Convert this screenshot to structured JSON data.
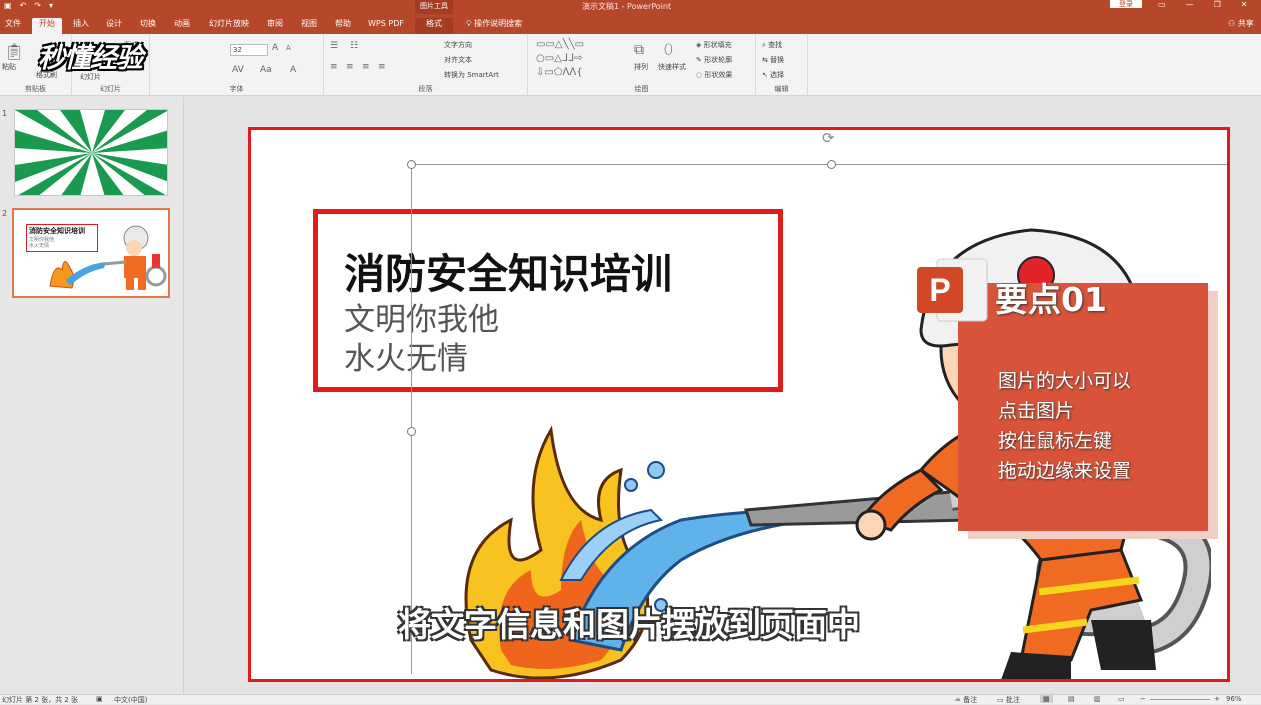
{
  "window": {
    "doc_title": "演示文稿1 - PowerPoint",
    "tool_title": "图片工具",
    "login": "登录",
    "share": "共享",
    "tell_me": "操作说明搜索"
  },
  "tabs": [
    {
      "label": "文件"
    },
    {
      "label": "开始"
    },
    {
      "label": "插入"
    },
    {
      "label": "设计"
    },
    {
      "label": "切换"
    },
    {
      "label": "动画"
    },
    {
      "label": "幻灯片放映"
    },
    {
      "label": "审阅"
    },
    {
      "label": "视图"
    },
    {
      "label": "帮助"
    },
    {
      "label": "WPS PDF"
    },
    {
      "label": "格式"
    }
  ],
  "ribbon": {
    "clipboard": {
      "paste": "粘贴",
      "format_painter": "格式刷",
      "label": "剪贴板"
    },
    "slides": {
      "new_slide": "幻灯片",
      "layout": "版式",
      "label": "幻灯片"
    },
    "font": {
      "size": "32",
      "label": "字体"
    },
    "paragraph": {
      "text_direction": "文字方向",
      "align_text": "对齐文本",
      "smartart": "转换为 SmartArt",
      "label": "段落"
    },
    "drawing": {
      "arrange": "排列",
      "quick_styles": "快速样式",
      "fill": "形状填充",
      "outline": "形状轮廓",
      "effects": "形状效果",
      "label": "绘图"
    },
    "editing": {
      "find": "查找",
      "replace": "替换",
      "select": "选择",
      "label": "编辑"
    }
  },
  "watermark": "秒懂经验",
  "thumbnails": [
    {
      "number": "1"
    },
    {
      "number": "2",
      "title": "消防安全知识培训",
      "line1": "文明你我他",
      "line2": "水火无情"
    }
  ],
  "slide": {
    "title": "消防安全知识培训",
    "subtitle1": "文明你我他",
    "subtitle2": "水火无情",
    "card_heading": "要点01",
    "card_lines": [
      "图片的大小可以",
      "点击图片",
      "按住鼠标左键",
      "拖动边缘来设置"
    ]
  },
  "caption": "将文字信息和图片摆放到页面中",
  "status": {
    "slide_info": "幻灯片 第 2 张，共 2 张",
    "language": "中文(中国)",
    "notes": "备注",
    "comments": "批注",
    "zoom": "96%"
  },
  "colors": {
    "accent": "#b7472a",
    "highlight": "#e01b1b",
    "card": "#d9533a"
  }
}
